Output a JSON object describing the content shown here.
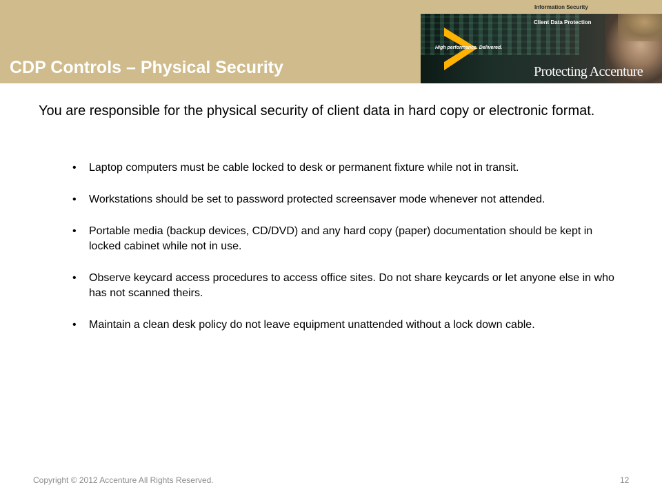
{
  "header": {
    "title": "CDP Controls – Physical Security",
    "top_label": "Information Security",
    "banner": {
      "subheading": "Client Data Protection",
      "tagline": "High performance. Delivered.",
      "protecting": "Protecting Accenture",
      "accent_color": "#ffb300"
    },
    "band_color": "#cfbb8b"
  },
  "main": {
    "intro": "You are responsible for the physical security of client data in hard copy or electronic format.",
    "bullet_glyph": "•",
    "bullets": [
      "Laptop computers must be cable locked to desk or permanent fixture while not in transit.",
      "Workstations should be set to password protected screensaver mode whenever not attended.",
      "Portable media (backup devices, CD/DVD) and any hard copy (paper) documentation should be kept in locked cabinet while not in use.",
      "Observe keycard access procedures to access office sites.  Do not share keycards or let anyone else in who has not scanned theirs.",
      "Maintain a clean desk policy do not leave equipment unattended without a lock down cable."
    ]
  },
  "footer": {
    "copyright": "Copyright © 2012 Accenture  All Rights Reserved.",
    "page_number": "12"
  }
}
